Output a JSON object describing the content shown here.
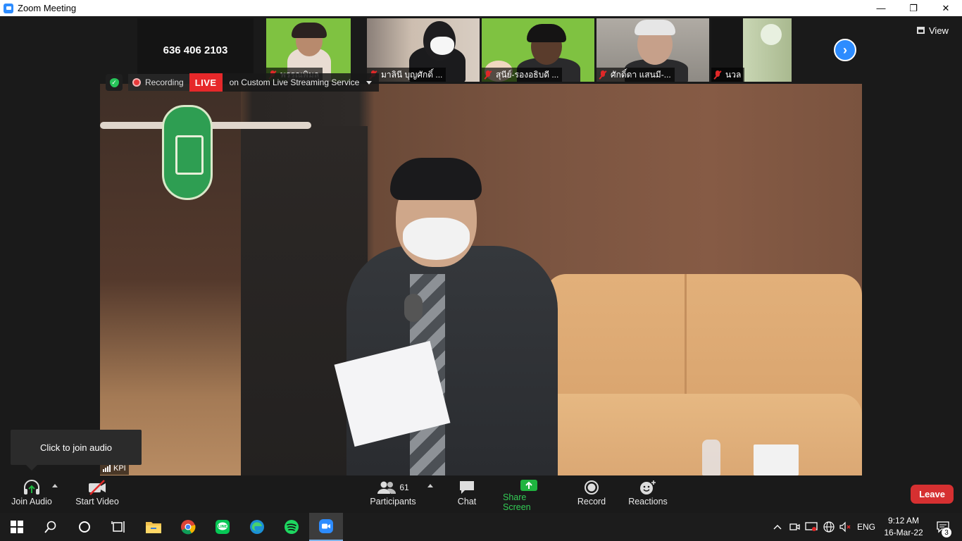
{
  "window": {
    "title": "Zoom Meeting",
    "minimize": "—",
    "maximize": "❐",
    "close": "✕"
  },
  "meeting": {
    "id": "636 406 2103"
  },
  "gallery": {
    "tiles": [
      {
        "name": "พรรณพิมล",
        "bg": "#7fc241"
      },
      {
        "name": "มาลินี บุญศักดิ์ ...",
        "bg": "#cbb7a8"
      },
      {
        "name": "สุนีย์-รองอธิบดี ...",
        "bg": "#7fc241"
      },
      {
        "name": "ศักดิ์ดา แสนมี-...",
        "bg": "#a9a39a"
      },
      {
        "name": "นวล",
        "bg": "#b8c8a8"
      }
    ],
    "view_label": "View"
  },
  "status": {
    "recording_label": "Recording",
    "live_label": "LIVE",
    "stream_label": "on Custom Live Streaming Service"
  },
  "video": {
    "participant_label": "KPI"
  },
  "tooltip": {
    "text": "Click to join audio"
  },
  "toolbar": {
    "join_audio": "Join Audio",
    "start_video": "Start Video",
    "participants_count": "61",
    "participants": "Participants",
    "chat": "Chat",
    "share_screen": "Share Screen",
    "record": "Record",
    "reactions": "Reactions",
    "leave": "Leave"
  },
  "taskbar": {
    "language": "ENG",
    "time": "9:12 AM",
    "date": "16-Mar-22",
    "notifications": "3"
  },
  "colors": {
    "accent": "#2d8cff",
    "share_green": "#1fb43f",
    "live_red": "#e6282a",
    "leave_red": "#d63031"
  }
}
